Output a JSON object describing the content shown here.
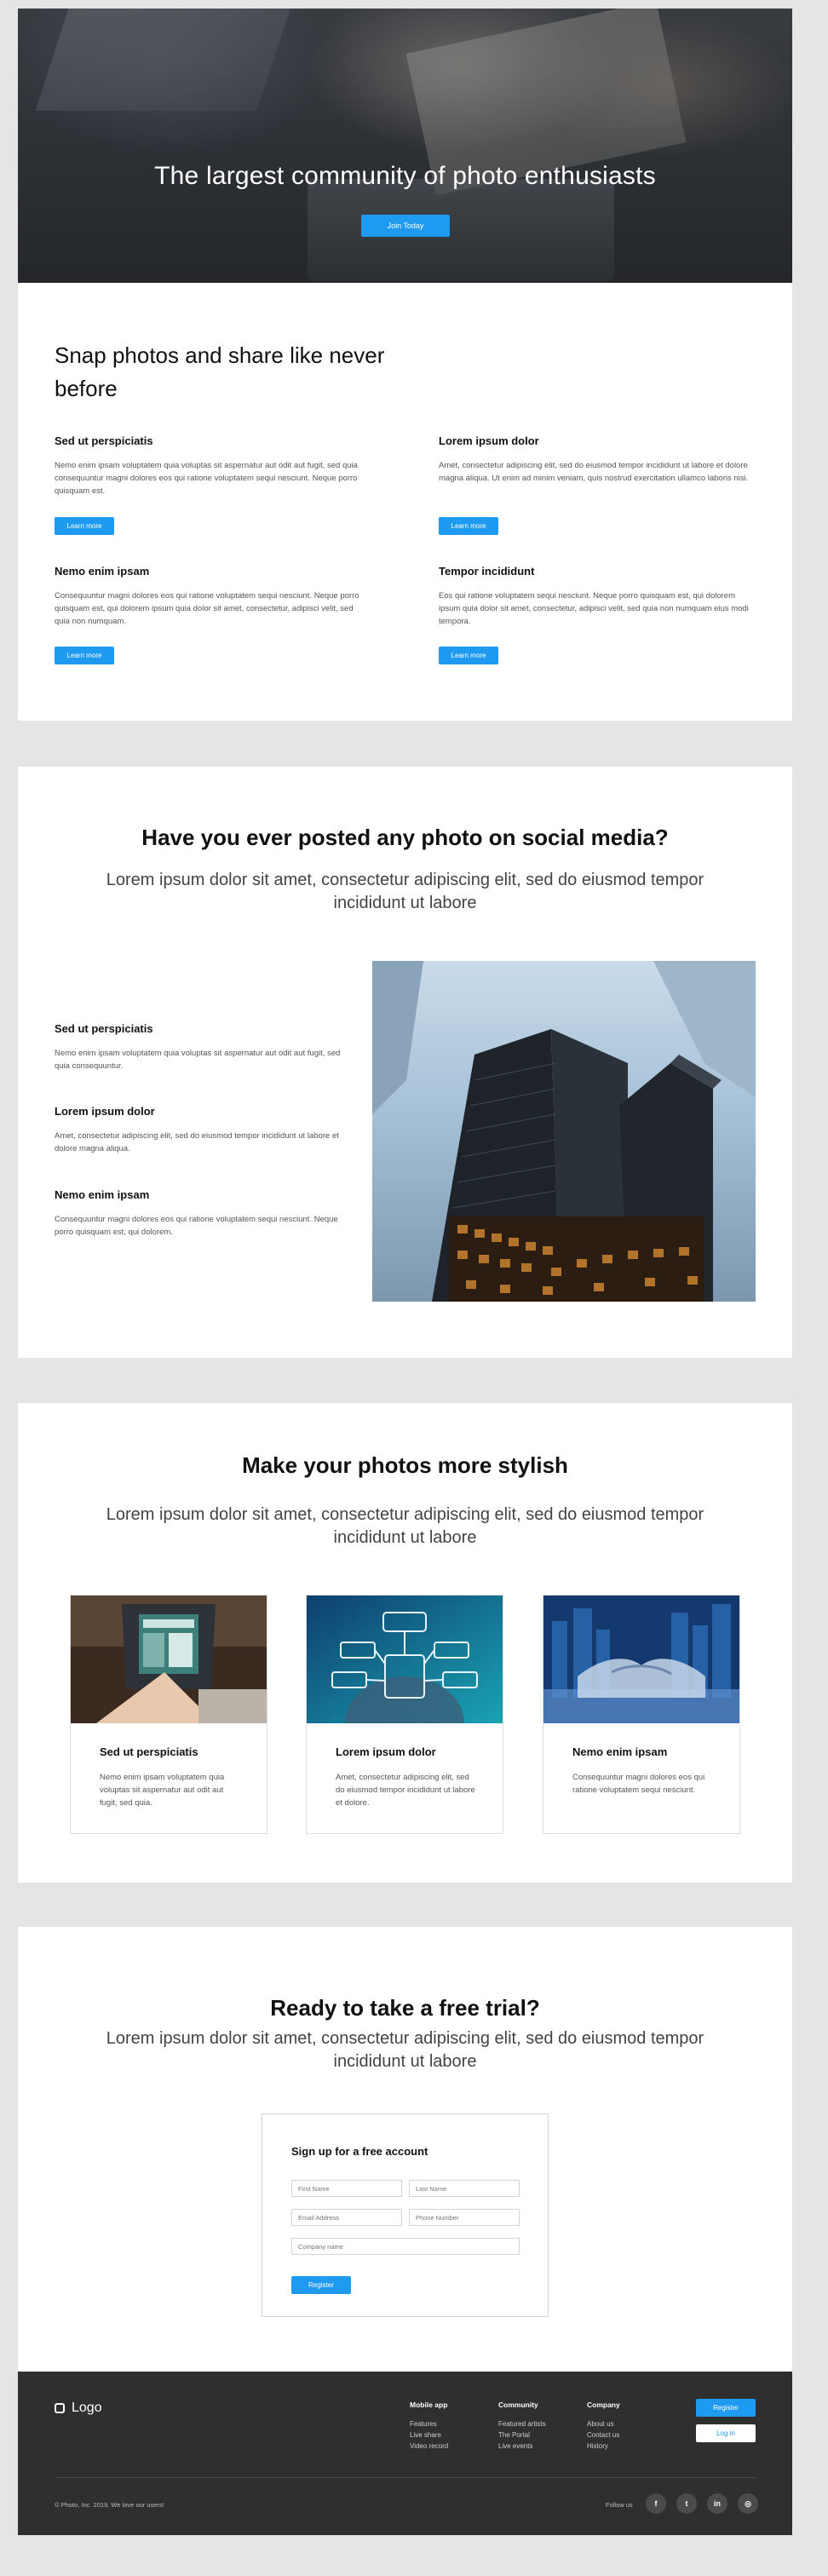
{
  "hero": {
    "title": "The largest community of photo enthusiasts",
    "cta_label": "Join Today"
  },
  "features_section": {
    "title": "Snap photos and share like never before",
    "items": [
      {
        "title": "Sed ut perspiciatis",
        "text": "Nemo enim ipsam voluptatem quia voluptas sit aspernatur aut odit aut fugit, sed quia consequuntur magni dolores eos qui ratione voluptatem sequi nesciunt. Neque porro quisquam est.",
        "button": "Learn more"
      },
      {
        "title": "Lorem ipsum dolor",
        "text": "Amet, consectetur adipiscing elit, sed do eiusmod tempor incididunt ut labore et dolore magna aliqua. Ut enim ad minim veniam, quis nostrud exercitation ullamco laboris nisi.",
        "button": "Learn more"
      },
      {
        "title": "Nemo enim ipsam",
        "text": "Consequuntur magni dolores eos qui ratione voluptatem sequi nesciunt. Neque porro quisquam est, qui dolorem ipsum quia dolor sit amet, consectetur, adipisci velit, sed quia non numquam.",
        "button": "Learn more"
      },
      {
        "title": "Tempor incididunt",
        "text": "Eos qui ratione voluptatem sequi nesciunt. Neque porro quisquam est, qui dolorem ipsum quia dolor sit amet, consectetur, adipisci velit, sed quia non numquam eius modi tempora.",
        "button": "Learn more"
      }
    ]
  },
  "social_section": {
    "title": "Have you ever posted any photo on social media?",
    "subtitle": "Lorem ipsum dolor sit amet, consectetur adipiscing elit, sed do eiusmod tempor incididunt ut labore",
    "items": [
      {
        "title": "Sed ut perspiciatis",
        "text": "Nemo enim ipsam voluptatem quia voluptas sit aspernatur aut odit aut fugit, sed quia consequuntur."
      },
      {
        "title": "Lorem ipsum dolor",
        "text": "Amet, consectetur adipiscing elit, sed do eiusmod tempor incididunt ut labore et dolore magna aliqua."
      },
      {
        "title": "Nemo enim ipsam",
        "text": "Consequuntur magni dolores eos qui ratione voluptatem sequi nesciunt. Neque porro quisquam est, qui dolorem."
      }
    ]
  },
  "stylish_section": {
    "title": "Make your photos more stylish",
    "subtitle": "Lorem ipsum dolor sit amet, consectetur adipiscing elit, sed do eiusmod tempor incididunt ut labore",
    "cards": [
      {
        "title": "Sed ut perspiciatis",
        "text": "Nemo enim ipsam voluptatem quia voluptas sit aspernatur aut odit aut fugit, sed quia."
      },
      {
        "title": "Lorem ipsum dolor",
        "text": "Amet, consectetur adipiscing elit, sed do eiusmod tempor incididunt ut labore et dolore."
      },
      {
        "title": "Nemo enim ipsam",
        "text": "Consequuntur magni dolores eos qui ratione voluptatem sequi nesciunt."
      }
    ]
  },
  "trial_section": {
    "title": "Ready to take a free trial?",
    "subtitle": "Lorem ipsum dolor sit amet, consectetur adipiscing elit, sed do eiusmod tempor incididunt ut labore",
    "form": {
      "title": "Sign up for a free account",
      "first_name_placeholder": "First Name",
      "last_name_placeholder": "Last Name",
      "email_placeholder": "Email Address",
      "phone_placeholder": "Phone Number",
      "company_placeholder": "Company name",
      "submit_label": "Register"
    }
  },
  "footer": {
    "logo_text": "Logo",
    "columns": [
      {
        "title": "Mobile app",
        "links": [
          "Features",
          "Live share",
          "Video record"
        ]
      },
      {
        "title": "Community",
        "links": [
          "Featured artists",
          "The Portal",
          "Live events"
        ]
      },
      {
        "title": "Company",
        "links": [
          "About us",
          "Contact us",
          "History"
        ]
      }
    ],
    "register_label": "Register",
    "login_label": "Log in",
    "copyright": "© Photo, Inc. 2019. We love our users!",
    "follow_label": "Follow us",
    "social": [
      {
        "icon": "facebook-icon",
        "glyph": "f"
      },
      {
        "icon": "twitter-icon",
        "glyph": "t"
      },
      {
        "icon": "linkedin-icon",
        "glyph": "in"
      },
      {
        "icon": "instagram-icon",
        "glyph": "◎"
      }
    ]
  },
  "colors": {
    "accent": "#1e9bf0",
    "footer_bg": "#2f2f2f",
    "page_bg": "#e5e5e5"
  }
}
